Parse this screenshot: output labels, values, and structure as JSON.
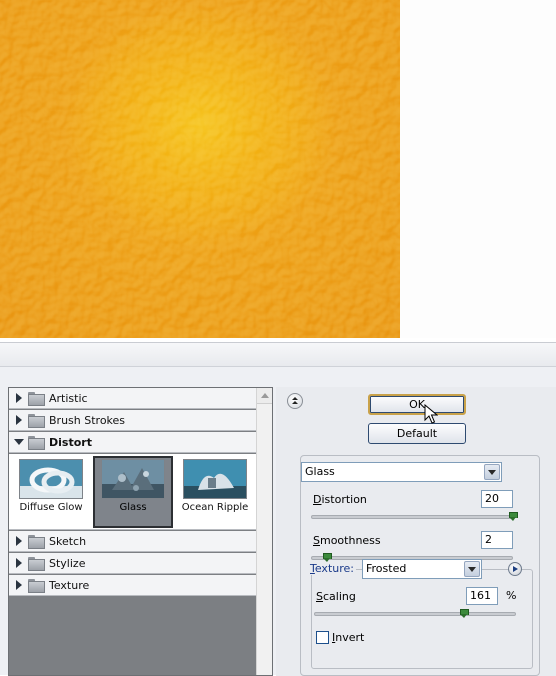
{
  "filter_categories": [
    {
      "label": "Artistic",
      "expanded": false
    },
    {
      "label": "Brush Strokes",
      "expanded": false
    },
    {
      "label": "Distort",
      "expanded": true
    },
    {
      "label": "Sketch",
      "expanded": false
    },
    {
      "label": "Stylize",
      "expanded": false
    },
    {
      "label": "Texture",
      "expanded": false
    }
  ],
  "distort_filters": [
    {
      "label": "Diffuse Glow",
      "selected": false
    },
    {
      "label": "Glass",
      "selected": true
    },
    {
      "label": "Ocean Ripple",
      "selected": false
    }
  ],
  "buttons": {
    "ok": "OK",
    "default": "Default"
  },
  "settings": {
    "filter": "Glass",
    "distortion": {
      "label_u": "D",
      "label_rest": "istortion",
      "value": "20",
      "level_fraction": 1.0
    },
    "smoothness": {
      "label_u": "S",
      "label_rest": "moothness",
      "value": "2",
      "level_fraction": 0.07
    },
    "texture": {
      "label_u": "T",
      "label_rest": "exture:",
      "value": "Frosted"
    },
    "scaling": {
      "label_u": "S",
      "label_rest": "caling",
      "value": "161",
      "unit": "%",
      "level_fraction": 0.74
    },
    "invert": {
      "label_u": "I",
      "label_rest": "nvert",
      "checked": false
    }
  },
  "colors": {
    "preview_center": "#f5c21a",
    "preview_edge": "#e89412",
    "slider_thumb": "#3c8a3c",
    "accent_label": "#1a3a8a"
  },
  "icons": [
    "folder-icon",
    "expand-triangle-icon",
    "collapse-arrow-icon",
    "dropdown-arrow-icon",
    "options-arrow-icon",
    "mouse-cursor-icon"
  ]
}
